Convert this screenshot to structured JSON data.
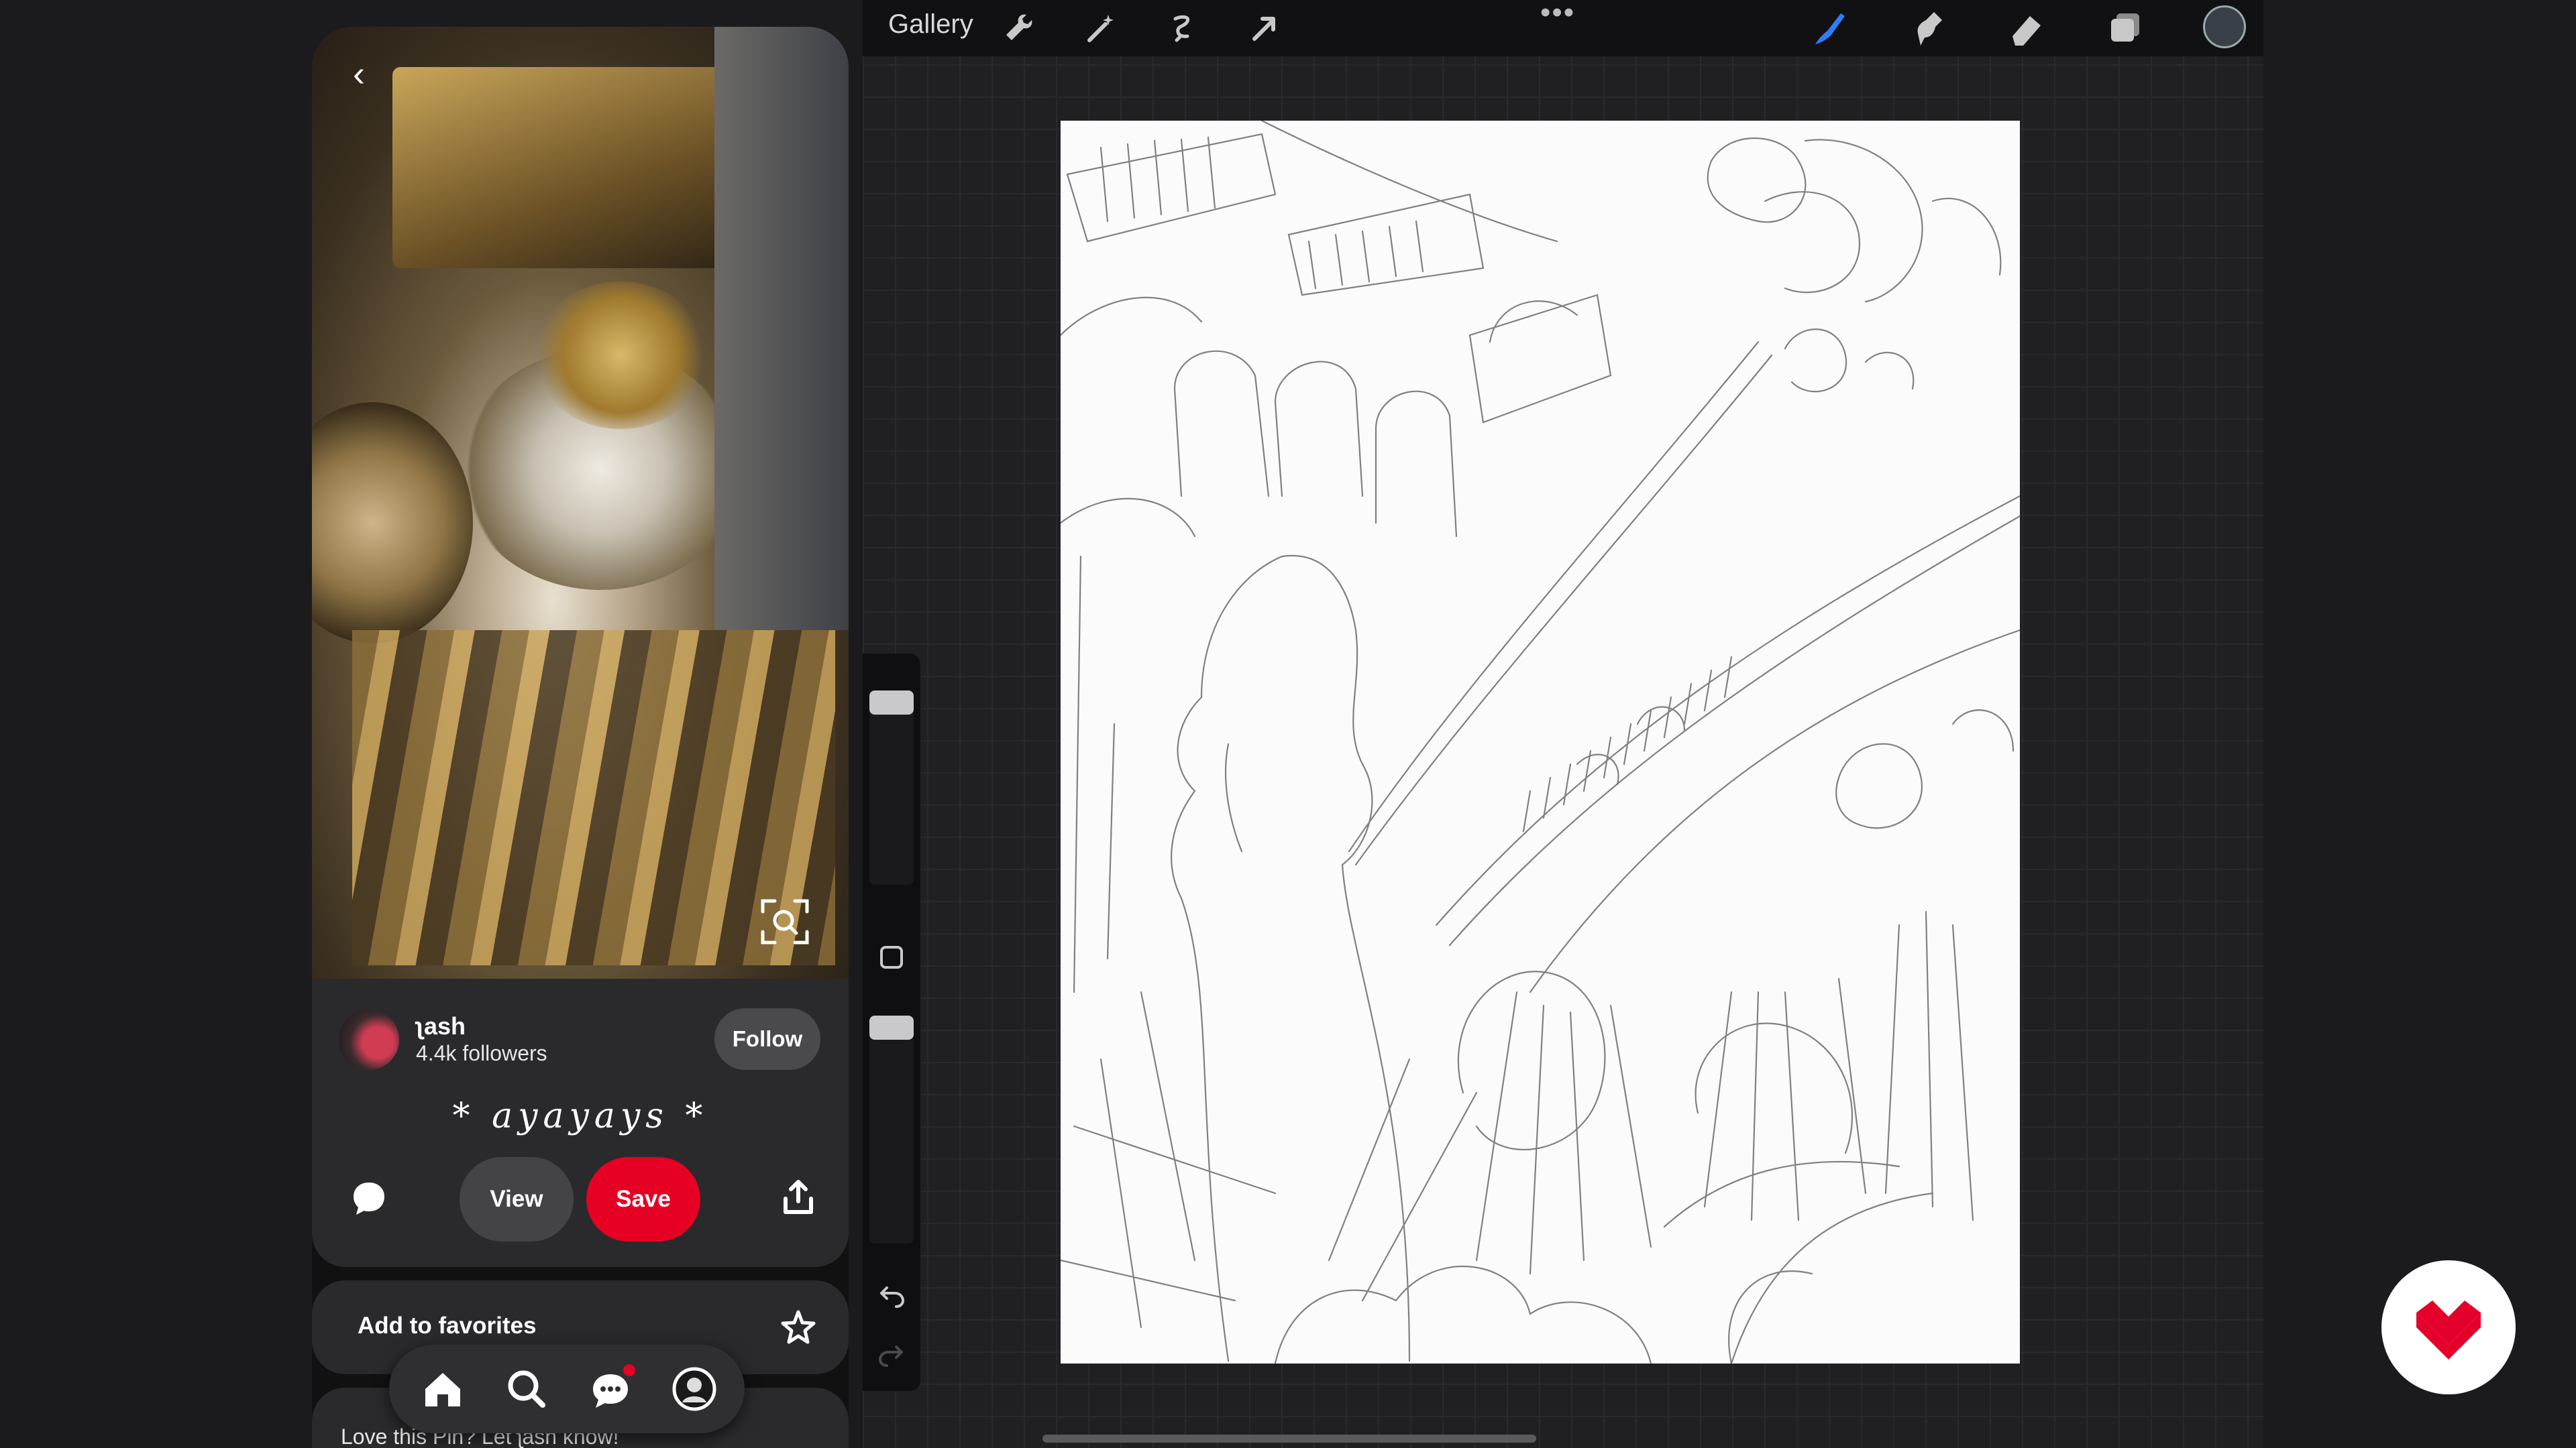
{
  "pin": {
    "back_icon": "chevron-left-icon",
    "lens_icon": "visual-search-icon",
    "author": {
      "name": "ʅash",
      "followers": "4.4k followers"
    },
    "follow_label": "Follow",
    "title": "* ayayays *",
    "comment_icon": "comment-icon",
    "view_label": "View",
    "save_label": "Save",
    "share_icon": "share-icon",
    "favorites_label": "Add to favorites",
    "favorites_icon": "star-icon",
    "love_text": "Love this Pin? Let ʅash know!",
    "tabs": [
      "home-icon",
      "search-icon",
      "messages-icon",
      "profile-icon"
    ],
    "messages_badge": true,
    "colors": {
      "save": "#e60023",
      "panel": "#2a2a2c"
    }
  },
  "procreate": {
    "gallery_label": "Gallery",
    "left_tools": [
      "wrench-icon",
      "magic-wand-icon",
      "selection-icon",
      "transform-arrow-icon"
    ],
    "more_label": "•••",
    "right_tools": [
      "brush-icon",
      "smudge-icon",
      "eraser-icon",
      "layers-icon"
    ],
    "current_color": "#3a4048",
    "brush_color": "#2f7cf6",
    "sidebar": {
      "modify_icon": "square-icon",
      "undo_icon": "undo-icon",
      "redo_icon": "redo-icon"
    }
  },
  "watermark": {
    "logo": "domestika-logo"
  }
}
